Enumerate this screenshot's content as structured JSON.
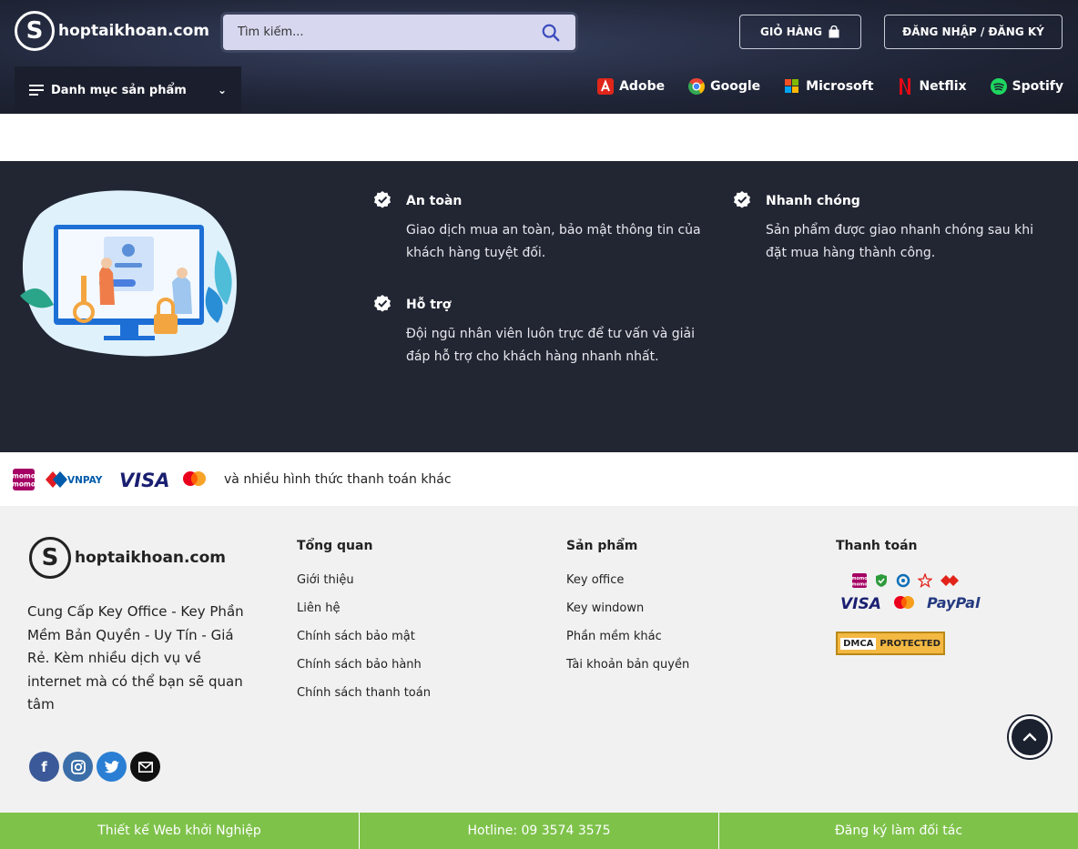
{
  "header": {
    "logo_text": "hoptaikhoan.com",
    "search_placeholder": "Tìm kiếm...",
    "cart_label": "GIỎ HÀNG",
    "login_label": "ĐĂNG NHẬP / ĐĂNG KÝ",
    "category_menu": "Danh mục sản phẩm",
    "brands": [
      {
        "label": "Adobe",
        "icon": "adobe-icon",
        "color": "#e0261a"
      },
      {
        "label": "Google",
        "icon": "google-icon",
        "color": "#4285f4"
      },
      {
        "label": "Microsoft",
        "icon": "microsoft-icon",
        "color": "#f25022"
      },
      {
        "label": "Netflix",
        "icon": "netflix-icon",
        "color": "#e50914"
      },
      {
        "label": "Spotify",
        "icon": "spotify-icon",
        "color": "#1ed760"
      }
    ]
  },
  "features": {
    "items": [
      {
        "title": "An toàn",
        "text": "Giao dịch mua an toàn, bảo mật thông tin của khách hàng tuyệt đối."
      },
      {
        "title": "Nhanh chóng",
        "text": "Sản phẩm được giao nhanh chóng sau khi đặt mua hàng thành công."
      },
      {
        "title": "Hỗ trợ",
        "text": "Đội ngũ nhân viên luôn trực để tư vấn và giải đáp hỗ trợ cho khách hàng nhanh nhất."
      }
    ]
  },
  "payment_strip": {
    "text": "và nhiều hình thức thanh toán khác",
    "logos": [
      "momo",
      "VNPAY",
      "VISA",
      "mastercard"
    ]
  },
  "footer": {
    "logo_text": "hoptaikhoan.com",
    "description": "Cung Cấp Key Office - Key Phần Mềm Bản Quyền - Uy Tín - Giá Rẻ. Kèm nhiều dịch vụ về internet mà có thể bạn sẽ quan tâm",
    "columns": [
      {
        "title": "Tổng quan",
        "links": [
          "Giới thiệu",
          "Liên hệ",
          "Chính sách bảo mật",
          "Chính sách bảo hành",
          "Chính sách thanh toán"
        ]
      },
      {
        "title": "Sản phẩm",
        "links": [
          "Key office",
          "Key windown",
          "Phần mềm khác",
          "Tài khoản bản quyền"
        ]
      },
      {
        "title": "Thanh toán",
        "links": []
      }
    ],
    "payment_logos": [
      "momo",
      "VISA",
      "mastercard",
      "PayPal"
    ],
    "dmca": {
      "left": "DMCA",
      "right": "PROTECTED"
    },
    "socials": [
      "facebook-icon",
      "instagram-icon",
      "twitter-icon",
      "email-icon"
    ]
  },
  "bottom_bar": {
    "items": [
      "Thiết kế Web khởi Nghiệp",
      "Hotline: 09 3574 3575",
      "Đăng ký làm đối tác"
    ],
    "color": "#7ec24a"
  }
}
